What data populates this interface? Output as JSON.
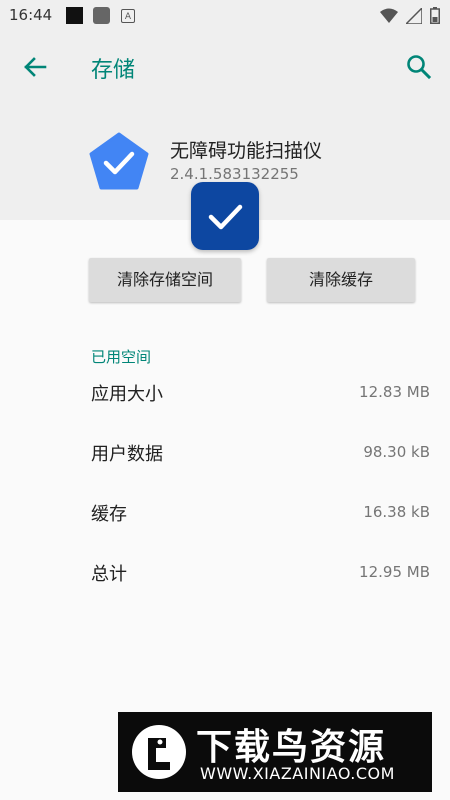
{
  "status_bar": {
    "time": "16:44",
    "notif_a_glyph": "A",
    "icons": [
      "black-square-icon",
      "gray-square-icon",
      "a-notification-icon",
      "wifi-icon",
      "signal-icon",
      "battery-icon"
    ]
  },
  "toolbar": {
    "title": "存储",
    "back_icon": "arrow-back-icon",
    "search_icon": "search-icon"
  },
  "app": {
    "name": "无障碍功能扫描仪",
    "version": "2.4.1.583132255",
    "icon": "pentagon-check-icon"
  },
  "buttons": {
    "clear_storage": "清除存储空间",
    "clear_cache": "清除缓存"
  },
  "usage": {
    "section_title": "已用空间",
    "rows": [
      {
        "label": "应用大小",
        "value": "12.83 MB"
      },
      {
        "label": "用户数据",
        "value": "98.30 kB"
      },
      {
        "label": "缓存",
        "value": "16.38 kB"
      },
      {
        "label": "总计",
        "value": "12.95 MB"
      }
    ]
  },
  "banner": {
    "title": "下载鸟资源",
    "url": "WWW.XIAZAINIAO.COM"
  },
  "colors": {
    "accent": "#008577",
    "header_bg": "#efefef",
    "overlay_blue": "#0d47a1",
    "app_icon_blue": "#4285f4"
  }
}
